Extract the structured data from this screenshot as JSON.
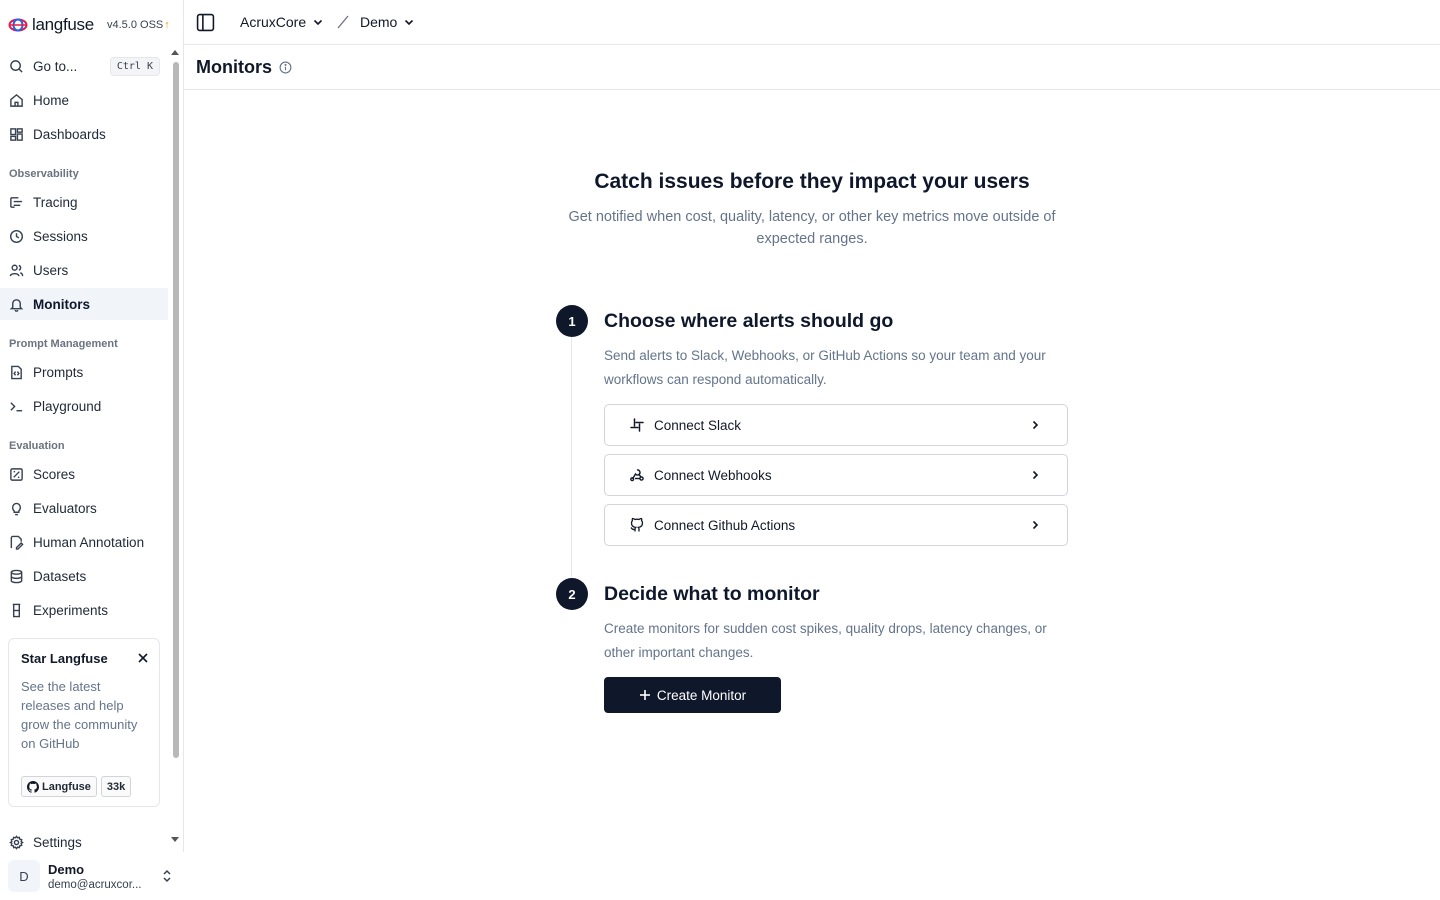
{
  "brand": {
    "name": "langfuse",
    "version": "v4.5.0 OSS"
  },
  "sidebar": {
    "goto": {
      "label": "Go to...",
      "shortcut": "Ctrl K"
    },
    "top_items": [
      {
        "label": "Home",
        "icon": "home-icon"
      },
      {
        "label": "Dashboards",
        "icon": "dashboard-icon"
      }
    ],
    "sections": [
      {
        "label": "Observability",
        "items": [
          {
            "label": "Tracing",
            "icon": "tracing-icon"
          },
          {
            "label": "Sessions",
            "icon": "clock-icon"
          },
          {
            "label": "Users",
            "icon": "users-icon"
          },
          {
            "label": "Monitors",
            "icon": "bell-icon",
            "active": true
          }
        ]
      },
      {
        "label": "Prompt Management",
        "items": [
          {
            "label": "Prompts",
            "icon": "file-code-icon"
          },
          {
            "label": "Playground",
            "icon": "terminal-icon"
          }
        ]
      },
      {
        "label": "Evaluation",
        "items": [
          {
            "label": "Scores",
            "icon": "scores-icon"
          },
          {
            "label": "Evaluators",
            "icon": "lightbulb-icon"
          },
          {
            "label": "Human Annotation",
            "icon": "annotation-icon"
          },
          {
            "label": "Datasets",
            "icon": "database-icon"
          },
          {
            "label": "Experiments",
            "icon": "flask-icon"
          }
        ]
      }
    ],
    "star_card": {
      "title": "Star Langfuse",
      "text": "See the latest releases and help grow the community on GitHub",
      "repo_label": "Langfuse",
      "stars": "33k"
    },
    "settings_label": "Settings",
    "user": {
      "initial": "D",
      "name": "Demo",
      "email": "demo@acruxcor..."
    }
  },
  "topbar": {
    "organization": "AcruxCore",
    "project": "Demo"
  },
  "page": {
    "title": "Monitors",
    "hero_title": "Catch issues before they impact your users",
    "hero_subtitle": "Get notified when cost, quality, latency, or other key metrics move outside of expected ranges.",
    "steps": [
      {
        "number": "1",
        "title": "Choose where alerts should go",
        "description": "Send alerts to Slack, Webhooks, or GitHub Actions so your team and your workflows can respond automatically.",
        "actions": [
          {
            "label": "Connect Slack",
            "icon": "slack-icon"
          },
          {
            "label": "Connect Webhooks",
            "icon": "webhook-icon"
          },
          {
            "label": "Connect Github Actions",
            "icon": "github-icon"
          }
        ]
      },
      {
        "number": "2",
        "title": "Decide what to monitor",
        "description": "Create monitors for sudden cost spikes, quality drops, latency changes, or other important changes.",
        "button": "Create Monitor"
      }
    ]
  },
  "colors": {
    "primary": "#0f172a",
    "muted_text": "#64748b",
    "border": "#e5e7eb",
    "active_bg": "#f1f5f9"
  }
}
